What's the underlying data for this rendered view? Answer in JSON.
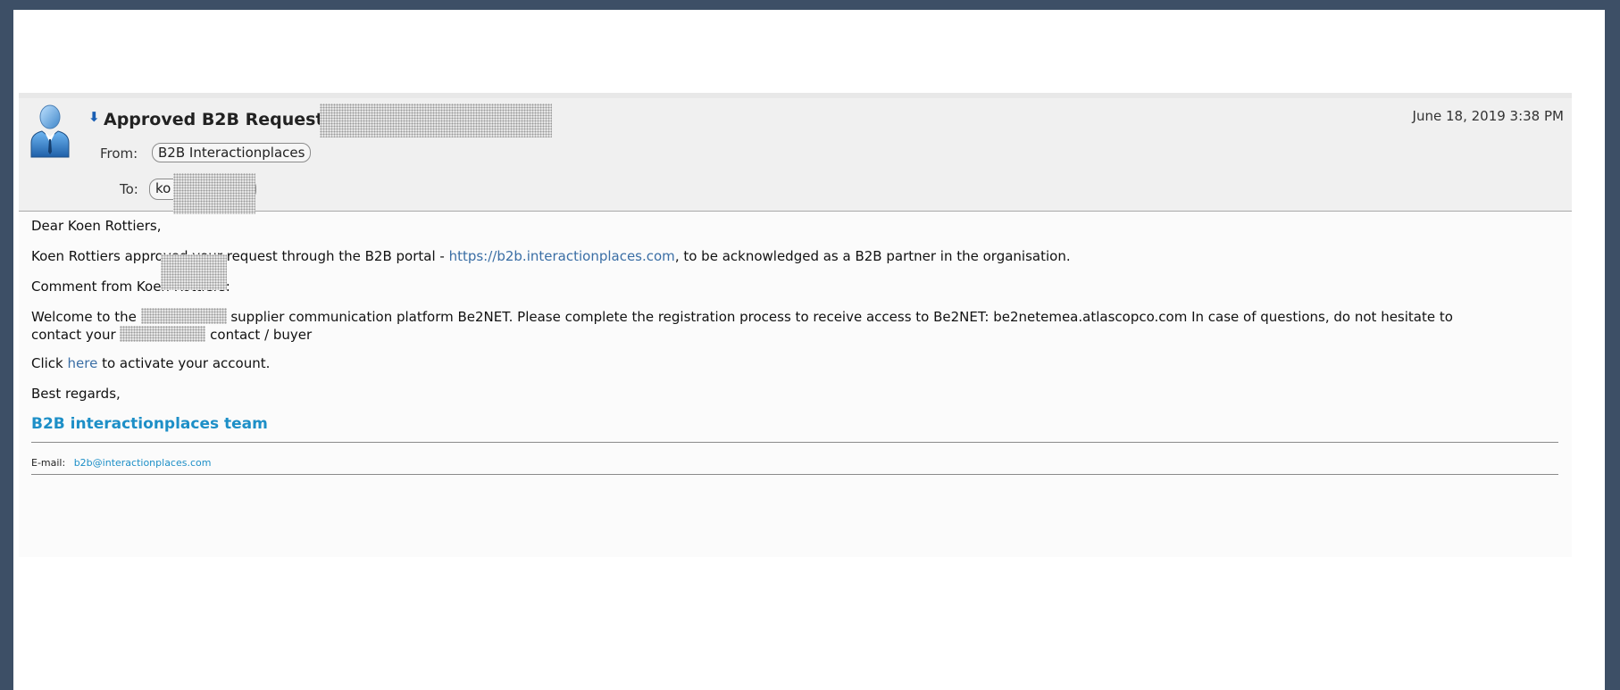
{
  "email": {
    "subject": "Approved B2B Request - I",
    "date": "June 18, 2019 3:38 PM",
    "from_label": "From:",
    "from_value": "B2B Interactionplaces",
    "to_label": "To:",
    "to_value": "ko",
    "greeting": "Dear Koen Rottiers,",
    "p1_before": "Koen Rottiers approved your request through the B2B portal - ",
    "p1_link": "https://b2b.interactionplaces.com",
    "p1_after": ", to be acknowledged as a B2B partner in the organisation.",
    "comment": "Comment from Koen Rottiers:",
    "p2_a": "Welcome to the ",
    "p2_b": " supplier communication platform Be2NET. Please complete the registration process to receive access to Be2NET: be2netemea.atlascopco.com In case of questions, do not hesitate to",
    "p2_c": "contact your ",
    "p2_d": " contact / buyer",
    "click_before": "Click ",
    "click_link": "here",
    "click_after": " to activate your account.",
    "regards": "Best regards,",
    "team": "B2B interactionplaces team",
    "email_label": "E-mail:",
    "email_value": "b2b@interactionplaces.com"
  },
  "colors": {
    "link": "#3a6ea5",
    "team": "#1d8fc7",
    "frame": "#3d4f66"
  },
  "icons": {
    "avatar": "user-avatar-icon",
    "arrow": "low-priority-arrow-icon"
  }
}
